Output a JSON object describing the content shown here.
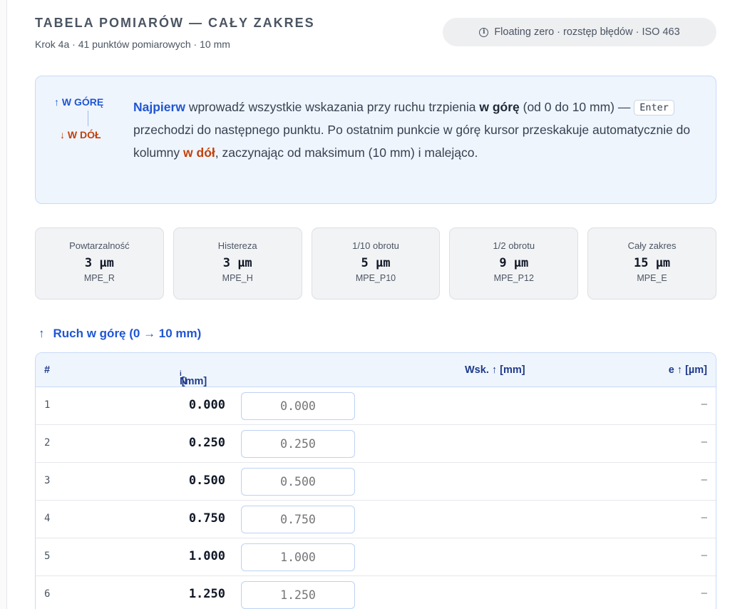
{
  "header": {
    "title": "TABELA POMIARÓW — CAŁY ZAKRES",
    "subtitle": "Krok 4a · 41 punktów pomiarowych · 10 mm",
    "badge_icon": "info-circle-icon",
    "badge_text": "Floating zero · rozstęp błędów · ISO 463"
  },
  "info": {
    "up_label": "↑ W GÓRĘ",
    "down_label": "↓ W DÓŁ",
    "t1": "Najpierw",
    "t2": " wprowadź wszystkie wskazania przy ruchu trzpienia ",
    "t3": "w górę",
    "t4": " (od 0 do 10 mm) — ",
    "kbd": "Enter",
    "t5": " przechodzi do następnego punktu. Po ostatnim punkcie w górę kursor przeskakuje automatycznie do kolumny ",
    "t6": "w dół",
    "t7": ", zaczynając od maksimum (10 mm) i malejąco."
  },
  "cards": [
    {
      "label": "Powtarzalność",
      "value": "3 µm",
      "code": "MPE_R"
    },
    {
      "label": "Histereza",
      "value": "3 µm",
      "code": "MPE_H"
    },
    {
      "label": "1/10 obrotu",
      "value": "5 µm",
      "code": "MPE_P10"
    },
    {
      "label": "1/2 obrotu",
      "value": "9 µm",
      "code": "MPE_P12"
    },
    {
      "label": "Cały zakres",
      "value": "15 µm",
      "code": "MPE_E"
    }
  ],
  "section": {
    "arrow": "↑",
    "title": "Ruch w górę (0 → 10 mm)"
  },
  "table": {
    "col_num": "#",
    "col_ni_base": "N",
    "col_ni_sub": "i",
    "col_ni_unit": " [mm]",
    "col_wsk": "Wsk. ↑ [mm]",
    "col_e": "e ↑ [µm]",
    "rows": [
      {
        "num": "1",
        "ni": "0.000",
        "placeholder": "0.000",
        "e": "–"
      },
      {
        "num": "2",
        "ni": "0.250",
        "placeholder": "0.250",
        "e": "–"
      },
      {
        "num": "3",
        "ni": "0.500",
        "placeholder": "0.500",
        "e": "–"
      },
      {
        "num": "4",
        "ni": "0.750",
        "placeholder": "0.750",
        "e": "–"
      },
      {
        "num": "5",
        "ni": "1.000",
        "placeholder": "1.000",
        "e": "–"
      },
      {
        "num": "6",
        "ni": "1.250",
        "placeholder": "1.250",
        "e": "–"
      }
    ]
  },
  "colors": {
    "accent_blue": "#2056d3",
    "accent_orange": "#c2410c",
    "panel_bg": "#eff5fd",
    "panel_border": "#c8daf6"
  }
}
